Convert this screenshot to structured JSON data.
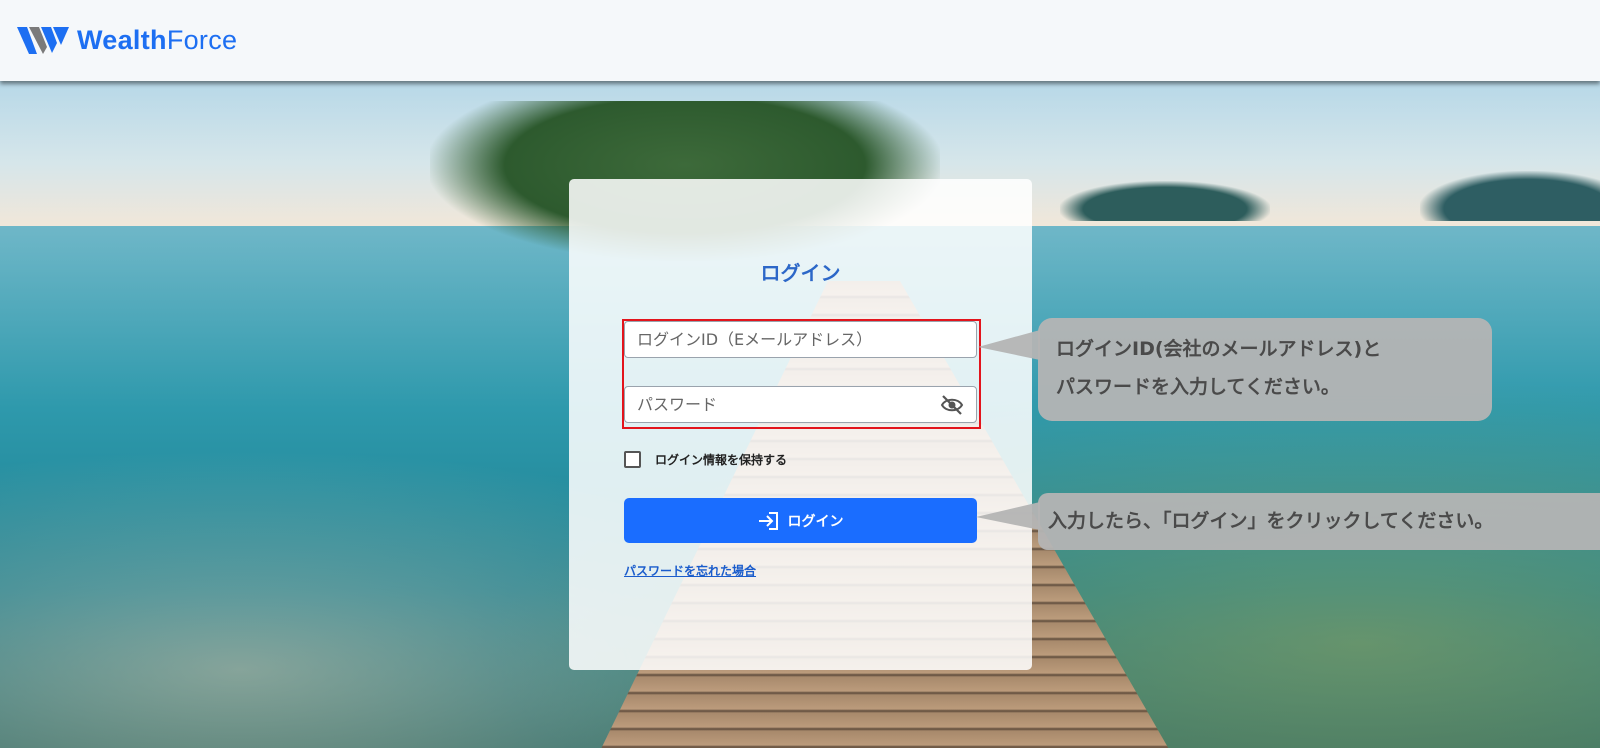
{
  "header": {
    "logo_text_bold": "Wealth",
    "logo_text_regular": "Force",
    "brand_color": "#1d6ff2"
  },
  "login": {
    "title": "ログイン",
    "id_placeholder": "ログインID（Eメールアドレス）",
    "password_placeholder": "パスワード",
    "password_toggle_icon": "eye-off-icon",
    "remember_label": "ログイン情報を保持する",
    "remember_checked": false,
    "button_label": "ログイン",
    "button_icon": "login-icon",
    "button_color": "#1a6dff",
    "forgot_link": "パスワードを忘れた場合"
  },
  "callouts": {
    "credentials_line1": "ログインID(会社のメールアドレス)と",
    "credentials_line2": "パスワードを入力してください。",
    "login_hint": "入力したら、「ログイン」をクリックしてください。"
  },
  "highlight_color": "#e3141c"
}
